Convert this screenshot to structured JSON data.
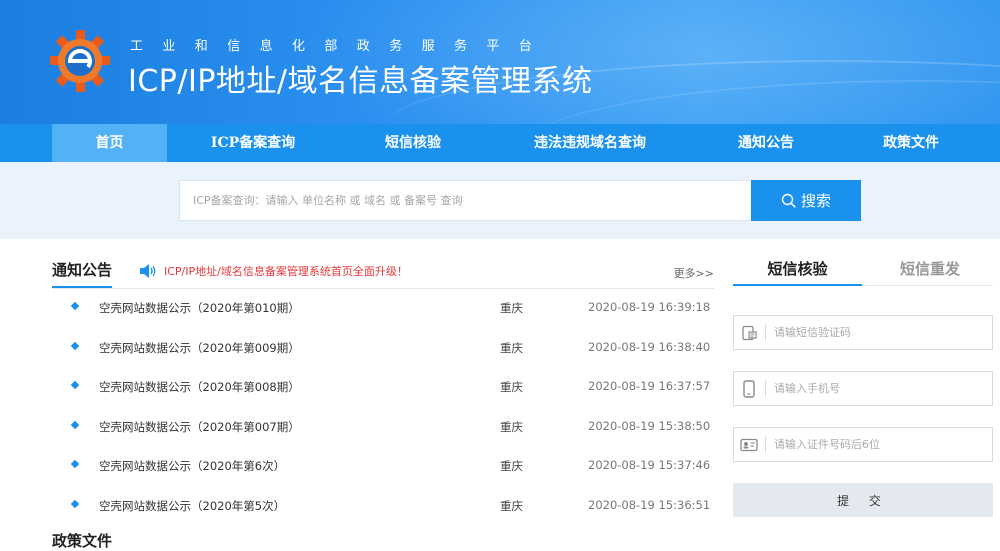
{
  "header": {
    "ministry": "工业和信息化部政务服务平台",
    "system_title": "ICP/IP地址/域名信息备案管理系统"
  },
  "nav": {
    "items": [
      {
        "label": "首页",
        "active": true
      },
      {
        "label": "ICP备案查询",
        "active": false
      },
      {
        "label": "短信核验",
        "active": false
      },
      {
        "label": "违法违规域名查询",
        "active": false
      },
      {
        "label": "通知公告",
        "active": false
      },
      {
        "label": "政策文件",
        "active": false
      }
    ]
  },
  "search": {
    "placeholder": "ICP备案查询：请输入 单位名称 或 域名 或 备案号 查询",
    "button_label": "搜索"
  },
  "notice": {
    "title": "通知公告",
    "marquee": "ICP/IP地址/域名信息备案管理系统首页全面升级！",
    "more": "更多>>",
    "items": [
      {
        "title": "空壳网站数据公示（2020年第010期）",
        "region": "重庆",
        "time": "2020-08-19 16:39:18"
      },
      {
        "title": "空壳网站数据公示（2020年第009期）",
        "region": "重庆",
        "time": "2020-08-19 16:38:40"
      },
      {
        "title": "空壳网站数据公示（2020年第008期）",
        "region": "重庆",
        "time": "2020-08-19 16:37:57"
      },
      {
        "title": "空壳网站数据公示（2020年第007期）",
        "region": "重庆",
        "time": "2020-08-19 15:38:50"
      },
      {
        "title": "空壳网站数据公示（2020年第6次）",
        "region": "重庆",
        "time": "2020-08-19 15:37:46"
      },
      {
        "title": "空壳网站数据公示（2020年第5次）",
        "region": "重庆",
        "time": "2020-08-19 15:36:51"
      }
    ]
  },
  "policy": {
    "title": "政策文件"
  },
  "sms": {
    "tab_verify": "短信核验",
    "tab_resend": "短信重发",
    "code_placeholder": "请输短信验证码",
    "phone_placeholder": "请输入手机号",
    "id_placeholder": "请输入证件号码后6位",
    "submit_label": "提 交"
  },
  "colors": {
    "primary": "#1a91ec",
    "nav_active": "#52b2f5",
    "search_band": "#eaf3fb",
    "marquee_red": "#e4393c"
  },
  "icons": {
    "logo": "miit-logo-icon",
    "search": "search-icon",
    "speaker": "speaker-icon",
    "bullet": "diamond-bullet-icon",
    "sms_code": "sms-code-icon",
    "phone": "mobile-phone-icon",
    "id_card": "id-card-icon"
  }
}
